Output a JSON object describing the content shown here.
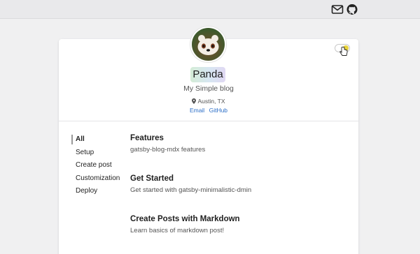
{
  "header": {
    "icons": [
      "mail-icon",
      "github-icon"
    ]
  },
  "profile": {
    "name": "Panda",
    "tagline": "My Simple blog",
    "location": "Austin, TX",
    "links": [
      {
        "label": "Email"
      },
      {
        "label": "GitHub"
      }
    ],
    "avatar_icon": "red-panda-avatar"
  },
  "theme_toggle": {
    "state": "on",
    "colors": {
      "knob": "#e8d33a"
    }
  },
  "sidebar": {
    "items": [
      {
        "label": "All",
        "active": true
      },
      {
        "label": "Setup"
      },
      {
        "label": "Create post"
      },
      {
        "label": "Customization"
      },
      {
        "label": "Deploy"
      }
    ]
  },
  "posts": [
    {
      "title": "Features",
      "description": "gatsby-blog-mdx features"
    },
    {
      "title": "Get Started",
      "description": "Get started with gatsby-minimalistic-dmin"
    },
    {
      "title": "Create Posts with Markdown",
      "description": "Learn basics of markdown post!"
    }
  ],
  "colors": {
    "link": "#2b6ec7",
    "background": "#f0f0f1"
  }
}
